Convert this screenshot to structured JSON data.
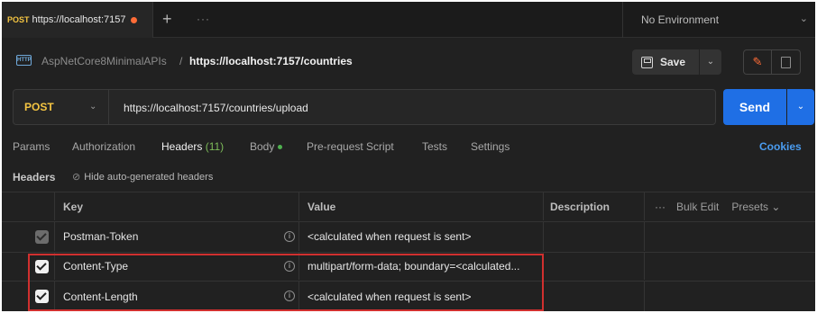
{
  "tab": {
    "method": "POST",
    "title": "https://localhost:7157"
  },
  "tab_bar": {
    "new_tab": "+",
    "more": "···"
  },
  "environment": {
    "label": "No Environment"
  },
  "breadcrumb": {
    "icon_text": "HTTP",
    "parent": "AspNetCore8MinimalAPIs",
    "separator": "/",
    "current": "https://localhost:7157/countries"
  },
  "toolbar": {
    "save_label": "Save"
  },
  "request": {
    "method": "POST",
    "url": "https://localhost:7157/countries/upload",
    "send_label": "Send"
  },
  "request_tabs": [
    {
      "label": "Params"
    },
    {
      "label": "Authorization"
    },
    {
      "label": "Headers",
      "count": "(11)"
    },
    {
      "label": "Body"
    },
    {
      "label": "Pre-request Script"
    },
    {
      "label": "Tests"
    },
    {
      "label": "Settings"
    }
  ],
  "cookies_label": "Cookies",
  "headers_section": {
    "label": "Headers",
    "hide_auto": "Hide auto-generated headers"
  },
  "table": {
    "columns": {
      "key": "Key",
      "value": "Value",
      "description": "Description",
      "more": "···",
      "bulk_edit": "Bulk Edit",
      "presets": "Presets"
    },
    "rows": [
      {
        "key": "Postman-Token",
        "value": "<calculated when request is sent>",
        "checked": true,
        "dimmed": true
      },
      {
        "key": "Content-Type",
        "value": "multipart/form-data; boundary=<calculated...",
        "checked": true,
        "dimmed": false
      },
      {
        "key": "Content-Length",
        "value": "<calculated when request is sent>",
        "checked": true,
        "dimmed": false
      }
    ]
  },
  "colors": {
    "accent_orange": "#ff6c37",
    "method_yellow": "#f5c542",
    "send_blue": "#1f6fe5",
    "link_blue": "#4a9cf0",
    "highlight_red": "#d0302f"
  }
}
